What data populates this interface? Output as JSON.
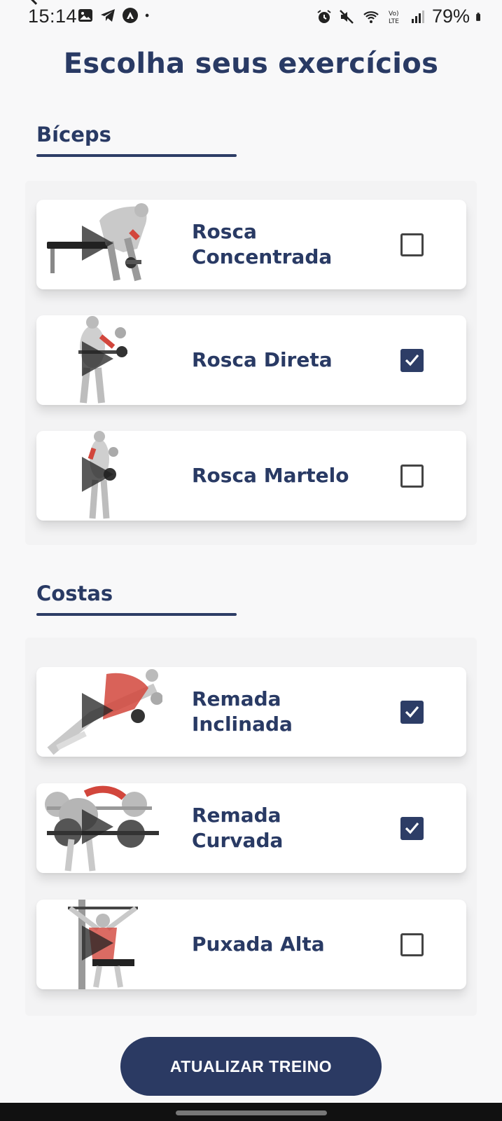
{
  "status_bar": {
    "time": "15:14",
    "battery": "79%",
    "icons_left": [
      "image-icon",
      "telegram-icon",
      "app-icon",
      "dot-icon"
    ],
    "icons_right": [
      "alarm-icon",
      "mute-icon",
      "wifi-icon",
      "volte-icon",
      "signal-icon",
      "battery-icon"
    ]
  },
  "page": {
    "title": "Escolha seus exercícios"
  },
  "sections": [
    {
      "title": "Bíceps",
      "items": [
        {
          "label": "Rosca Concentrada",
          "checked": false,
          "icon": "exercise-thumbnail"
        },
        {
          "label": "Rosca Direta",
          "checked": true,
          "icon": "exercise-thumbnail"
        },
        {
          "label": "Rosca Martelo",
          "checked": false,
          "icon": "exercise-thumbnail"
        }
      ]
    },
    {
      "title": "Costas",
      "items": [
        {
          "label": "Remada Inclinada",
          "checked": true,
          "icon": "exercise-thumbnail"
        },
        {
          "label": "Remada Curvada",
          "checked": true,
          "icon": "exercise-thumbnail"
        },
        {
          "label": "Puxada Alta",
          "checked": false,
          "icon": "exercise-thumbnail"
        }
      ]
    }
  ],
  "actions": {
    "update_button_label": "ATUALIZAR TREINO"
  },
  "colors": {
    "primary": "#2b3a63",
    "background": "#f8f8f9",
    "card": "#ffffff",
    "muscle_highlight": "#d2463c"
  }
}
